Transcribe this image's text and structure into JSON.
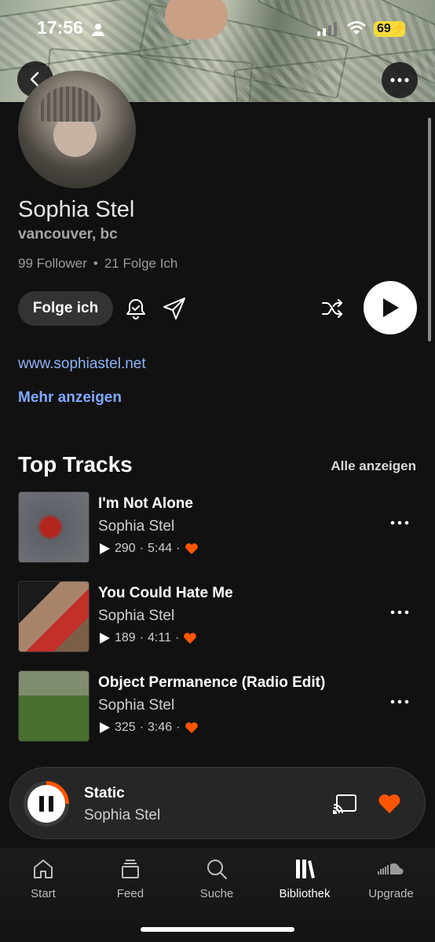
{
  "status_bar": {
    "time": "17:56",
    "battery": "69",
    "icons": [
      "person-icon",
      "signal-icon",
      "wifi-icon",
      "battery-icon"
    ]
  },
  "profile": {
    "name": "Sophia Stel",
    "location": "vancouver, bc",
    "followers": "99 Follower",
    "separator": "•",
    "following": "21 Folge Ich",
    "follow_label": "Folge ich",
    "website": "www.sophiastel.net",
    "more_label": "Mehr anzeigen"
  },
  "top_tracks": {
    "title": "Top Tracks",
    "see_all": "Alle anzeigen",
    "items": [
      {
        "title": "I'm Not Alone",
        "artist": "Sophia Stel",
        "plays": "290",
        "duration": "5:44"
      },
      {
        "title": "You Could Hate Me",
        "artist": "Sophia Stel",
        "plays": "189",
        "duration": "4:11"
      },
      {
        "title": "Object Permanence (Radio Edit)",
        "artist": "Sophia Stel",
        "plays": "325",
        "duration": "3:46"
      }
    ],
    "dot": "·"
  },
  "mini_player": {
    "title": "Static",
    "artist": "Sophia Stel",
    "progress": 0.25
  },
  "tabs": [
    {
      "label": "Start",
      "icon": "home-icon"
    },
    {
      "label": "Feed",
      "icon": "feed-icon"
    },
    {
      "label": "Suche",
      "icon": "search-icon"
    },
    {
      "label": "Bibliothek",
      "icon": "library-icon",
      "active": true
    },
    {
      "label": "Upgrade",
      "icon": "soundcloud-icon"
    }
  ],
  "colors": {
    "accent": "#ff5500",
    "link": "#8ab4f8",
    "background": "#111111"
  }
}
